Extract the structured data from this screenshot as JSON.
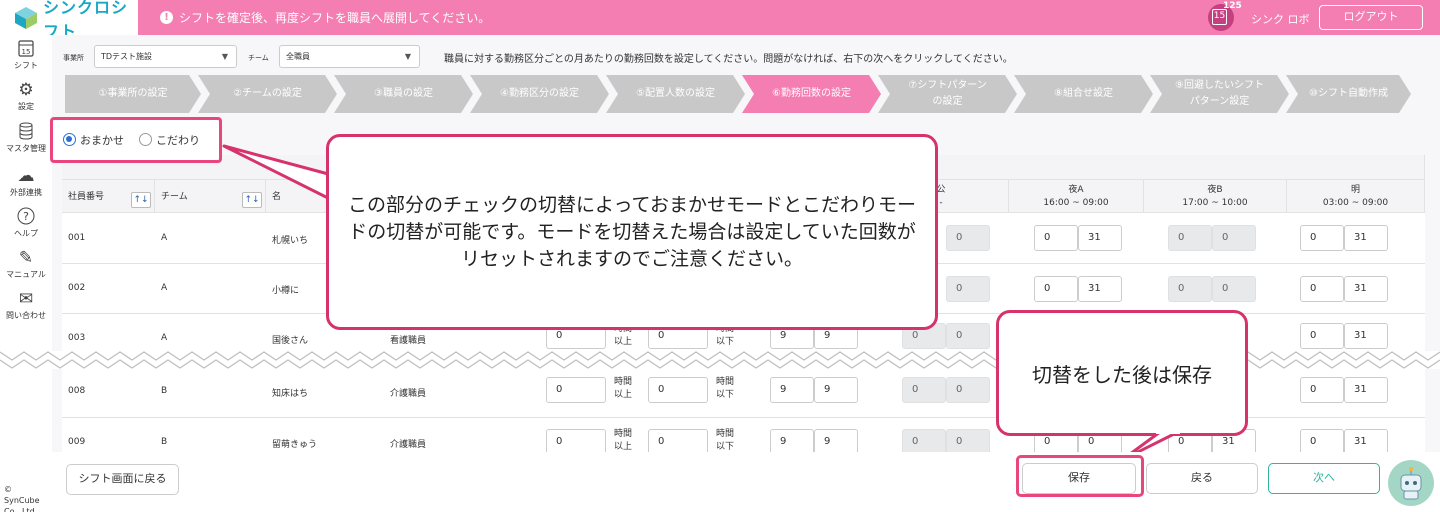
{
  "header": {
    "logo_text": "シンクロシフト",
    "notice": "シフトを確定後、再度シフトを職員へ展開してください。",
    "calendar_day": "15",
    "badge_count": "125",
    "user_name": "シンク ロボ",
    "logout_label": "ログアウト"
  },
  "sidebar": {
    "items": [
      {
        "label": "シフト",
        "icon": "calendar-icon",
        "day": "15"
      },
      {
        "label": "設定",
        "icon": "gear-icon"
      },
      {
        "label": "マスタ管理",
        "icon": "database-icon"
      },
      {
        "label": "外部連携",
        "icon": "cloud-sync-icon"
      },
      {
        "label": "ヘルプ",
        "icon": "help-icon"
      },
      {
        "label": "マニュアル",
        "icon": "edit-icon"
      },
      {
        "label": "問い合わせ",
        "icon": "mail-icon"
      }
    ],
    "copyright": "© SynCube Co., Ltd."
  },
  "filters": {
    "office_label": "事業所",
    "office_value": "TDテスト施設",
    "team_label": "チーム",
    "team_value": "全職員"
  },
  "instruction": "職員に対する勤務区分ごとの月あたりの勤務回数を設定してください。問題がなければ、右下の次へをクリックしてください。",
  "steps": [
    {
      "label": "①事業所の設定"
    },
    {
      "label": "②チームの設定"
    },
    {
      "label": "③職員の設定"
    },
    {
      "label": "④勤務区分の設定"
    },
    {
      "label": "⑤配置人数の設定"
    },
    {
      "label": "⑥勤務回数の設定"
    },
    {
      "label": "⑦シフトパターンの設定"
    },
    {
      "label": "⑧組合せ設定"
    },
    {
      "label": "⑨回避したいシフトパターン設定"
    },
    {
      "label": "⑩シフト自動作成"
    }
  ],
  "mode": {
    "omakase": "おまかせ",
    "kodawari": "こだわり",
    "selected": "omakase"
  },
  "table": {
    "headers": {
      "emp_no": "社員番号",
      "team": "チーム",
      "name": "名",
      "kou": "公",
      "kou_time": "-",
      "yoruA": "夜A",
      "yoruA_time": "16:00 ~ 09:00",
      "yoruB": "夜B",
      "yoruB_time": "17:00 ~ 10:00",
      "ake": "明",
      "ake_time": "03:00 ~ 09:00",
      "sort_icon": "↑↓"
    },
    "unit_hours": "時間",
    "unit_above": "以上",
    "unit_below": "以下",
    "rows": [
      {
        "emp_no": "001",
        "team": "A",
        "name": "札幌いち",
        "job": "",
        "h_min": "",
        "h_max": "",
        "a": "",
        "b": "",
        "k1": "0",
        "k2": "0",
        "ya1": "0",
        "ya2": "31",
        "yb1": "0",
        "yb2": "0",
        "ak1": "0",
        "ak2": "31"
      },
      {
        "emp_no": "002",
        "team": "A",
        "name": "小樽に",
        "job": "",
        "h_min": "",
        "h_max": "",
        "a": "",
        "b": "",
        "k1": "0",
        "k2": "0",
        "ya1": "0",
        "ya2": "31",
        "yb1": "0",
        "yb2": "0",
        "ak1": "0",
        "ak2": "31"
      },
      {
        "emp_no": "003",
        "team": "A",
        "name": "国後さん",
        "job": "看護職員",
        "h_min": "0",
        "h_max": "0",
        "a": "9",
        "b": "9",
        "k1": "0",
        "k2": "0",
        "ya1": "",
        "ya2": "",
        "yb1": "",
        "yb2": "",
        "ak1": "0",
        "ak2": "31"
      },
      {
        "emp_no": "008",
        "team": "B",
        "name": "知床はち",
        "job": "介護職員",
        "h_min": "0",
        "h_max": "0",
        "a": "9",
        "b": "9",
        "k1": "0",
        "k2": "0",
        "ya1": "",
        "ya2": "",
        "yb1": "",
        "yb2": "",
        "ak1": "0",
        "ak2": "31"
      },
      {
        "emp_no": "009",
        "team": "B",
        "name": "留萌きゅう",
        "job": "介護職員",
        "h_min": "0",
        "h_max": "0",
        "a": "9",
        "b": "9",
        "k1": "0",
        "k2": "0",
        "ya1": "0",
        "ya2": "0",
        "yb1": "0",
        "yb2": "31",
        "ak1": "0",
        "ak2": "31"
      }
    ]
  },
  "callouts": {
    "mode_text": "この部分のチェックの切替によっておまかせモードとこだわりモードの切替が可能です。モードを切替えた場合は設定していた回数がリセットされますのでご注意ください。",
    "save_text": "切替をした後は保存"
  },
  "footer": {
    "back_to_shift": "シフト画面に戻る",
    "save": "保存",
    "back": "戻る",
    "next": "次へ"
  },
  "colors": {
    "header_pink": "#f47eb1",
    "accent_pink": "#e8467c",
    "logo_teal": "#17a9c4",
    "next_teal": "#2fb69c"
  }
}
